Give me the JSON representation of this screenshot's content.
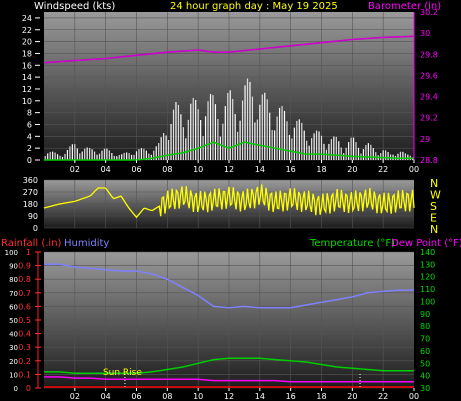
{
  "header": {
    "left_label": "Windspeed (kts)",
    "center_label": "24 hour graph day : May 19 2025",
    "right_label": "Barometer (in)"
  },
  "x_ticks": [
    "02",
    "04",
    "06",
    "08",
    "10",
    "12",
    "14",
    "16",
    "18",
    "20",
    "22",
    "00"
  ],
  "compass": [
    "N",
    "W",
    "S",
    "E",
    "N"
  ],
  "bottom_legend": {
    "rainfall": "Rainfall (.in)",
    "humidity": "Humidity",
    "temperature": "Temperature (°F)",
    "dewpoint": "Dew Point (°F)"
  },
  "sunrise_label": "Sun Rise",
  "colors": {
    "wind": "#ffffff",
    "gust": "#dddddd",
    "barometer": "#cc00cc",
    "wind_avg": "#00cc00",
    "direction": "#ffff00",
    "rainfall": "#ff0000",
    "humidity": "#8080ff",
    "temperature": "#00cc00",
    "dewpoint": "#ff00ff",
    "grid": "#555555"
  },
  "chart_data": [
    {
      "type": "line",
      "title": "24 hour graph day : May 19 2025",
      "xlabel": "",
      "ylabel": "Windspeed (kts)",
      "y2label": "Barometer (in)",
      "ylim": [
        0,
        25
      ],
      "y2lim": [
        28.8,
        30.2
      ],
      "yticks": [
        "0",
        "2",
        "4",
        "6",
        "8",
        "10",
        "12",
        "14",
        "16",
        "18",
        "20",
        "22",
        "24"
      ],
      "y2ticks": [
        "28.8",
        "29",
        "29.2",
        "29.4",
        "29.6",
        "29.8",
        "30",
        "30.2"
      ],
      "x_hours": [
        0,
        24
      ],
      "series": [
        {
          "name": "Windspeed (kts)",
          "axis": "left",
          "x": [
            0,
            1,
            2,
            3,
            4,
            5,
            6,
            7,
            7.5,
            8,
            8.5,
            9,
            9.5,
            10,
            10.5,
            11,
            11.5,
            12,
            12.5,
            13,
            13.5,
            14,
            14.5,
            15,
            15.5,
            16,
            16.5,
            17,
            17.5,
            18,
            18.5,
            19,
            19.5,
            20,
            20.5,
            21,
            21.5,
            22,
            22.5,
            23,
            23.5,
            24
          ],
          "y": [
            2,
            1,
            3,
            2,
            2,
            1,
            2,
            2,
            3,
            8,
            10,
            9,
            11,
            10,
            12,
            11,
            10,
            12,
            11,
            13,
            15,
            12,
            11,
            10,
            9,
            8,
            7,
            6,
            5,
            5,
            4,
            4,
            3,
            4,
            3,
            3,
            2,
            2,
            1,
            2,
            1,
            1
          ]
        },
        {
          "name": "Barometer (in)",
          "axis": "right",
          "x": [
            0,
            2,
            4,
            6,
            8,
            10,
            11,
            12,
            14,
            16,
            18,
            20,
            22,
            24
          ],
          "y": [
            29.72,
            29.74,
            29.76,
            29.79,
            29.82,
            29.84,
            29.82,
            29.82,
            29.85,
            29.88,
            29.91,
            29.94,
            29.96,
            29.97
          ]
        },
        {
          "name": "Wind average (kts)",
          "axis": "left",
          "x": [
            0,
            6,
            7,
            8,
            9,
            10,
            11,
            12,
            13,
            14,
            15,
            16,
            17,
            18,
            19,
            20,
            21,
            22,
            23,
            24
          ],
          "y": [
            0,
            0,
            0.3,
            0.8,
            1.2,
            2,
            3,
            2,
            3,
            2.5,
            2,
            1.5,
            1,
            1,
            0.8,
            0.6,
            0.5,
            0.4,
            0.3,
            0.3
          ]
        }
      ]
    },
    {
      "type": "line",
      "title": "",
      "xlabel": "",
      "ylabel": "",
      "ylim": [
        0,
        360
      ],
      "yticks": [
        "0",
        "90",
        "180",
        "270",
        "360"
      ],
      "series": [
        {
          "name": "Wind direction",
          "x": [
            0,
            1,
            2,
            3,
            3.5,
            4,
            4.5,
            5,
            5.5,
            6,
            6.5,
            7,
            8,
            9,
            10,
            11,
            12,
            13,
            14,
            15,
            16,
            17,
            18,
            19,
            20,
            21,
            22,
            23,
            24
          ],
          "y": [
            150,
            180,
            200,
            240,
            300,
            300,
            220,
            240,
            150,
            80,
            150,
            130,
            200,
            240,
            190,
            210,
            230,
            200,
            250,
            190,
            220,
            200,
            170,
            210,
            190,
            220,
            180,
            200,
            210
          ]
        }
      ]
    },
    {
      "type": "line",
      "title": "",
      "xlabel": "",
      "ylabel": "Humidity",
      "y2label": "Temperature (°F)",
      "ylim": [
        0,
        100
      ],
      "y2lim": [
        30,
        140
      ],
      "yticks": [
        "0",
        "10",
        "20",
        "30",
        "40",
        "50",
        "60",
        "70",
        "80",
        "90",
        "100"
      ],
      "y2ticks": [
        "30",
        "40",
        "50",
        "60",
        "70",
        "80",
        "90",
        "100",
        "110",
        "120",
        "130",
        "140"
      ],
      "rain_ticks": [
        "0",
        "0.1",
        "0.2",
        "0.3",
        "0.4",
        "0.5",
        "0.6",
        "0.7",
        "0.8",
        "0.9",
        "1"
      ],
      "sunrise_hour": 5.25,
      "sunset_hour": 20.5,
      "series": [
        {
          "name": "Humidity",
          "axis": "left",
          "x": [
            0,
            1,
            2,
            3,
            4,
            5,
            6,
            7,
            8,
            9,
            10,
            11,
            12,
            13,
            14,
            15,
            16,
            17,
            18,
            19,
            20,
            21,
            22,
            23,
            24
          ],
          "y": [
            91,
            91,
            89,
            88,
            87,
            86,
            86,
            84,
            80,
            74,
            68,
            60,
            59,
            60,
            59,
            59,
            59,
            61,
            63,
            65,
            67,
            70,
            71,
            72,
            72
          ]
        },
        {
          "name": "Temperature (°F)",
          "axis": "right",
          "x": [
            0,
            1,
            2,
            3,
            4,
            5,
            6,
            7,
            8,
            9,
            10,
            11,
            12,
            13,
            14,
            15,
            16,
            17,
            18,
            19,
            20,
            21,
            22,
            23,
            24
          ],
          "y": [
            43,
            43,
            42,
            42,
            42,
            42,
            42,
            43,
            45,
            47,
            50,
            53,
            54,
            54,
            54,
            53,
            52,
            51,
            49,
            47,
            46,
            45,
            44,
            44,
            44
          ]
        },
        {
          "name": "Dew Point (°F)",
          "axis": "right",
          "x": [
            0,
            1,
            2,
            3,
            4,
            5,
            6,
            7,
            8,
            9,
            10,
            11,
            12,
            13,
            14,
            15,
            16,
            17,
            18,
            19,
            20,
            21,
            22,
            23,
            24
          ],
          "y": [
            39,
            39,
            38,
            38,
            37,
            37,
            37,
            37,
            37,
            37,
            37,
            36,
            36,
            36,
            36,
            36,
            35,
            35,
            35,
            35,
            35,
            35,
            35,
            35,
            35
          ]
        },
        {
          "name": "Rainfall (.in)",
          "axis": "rain",
          "x": [
            0,
            24
          ],
          "y": [
            0,
            0
          ]
        }
      ]
    }
  ]
}
